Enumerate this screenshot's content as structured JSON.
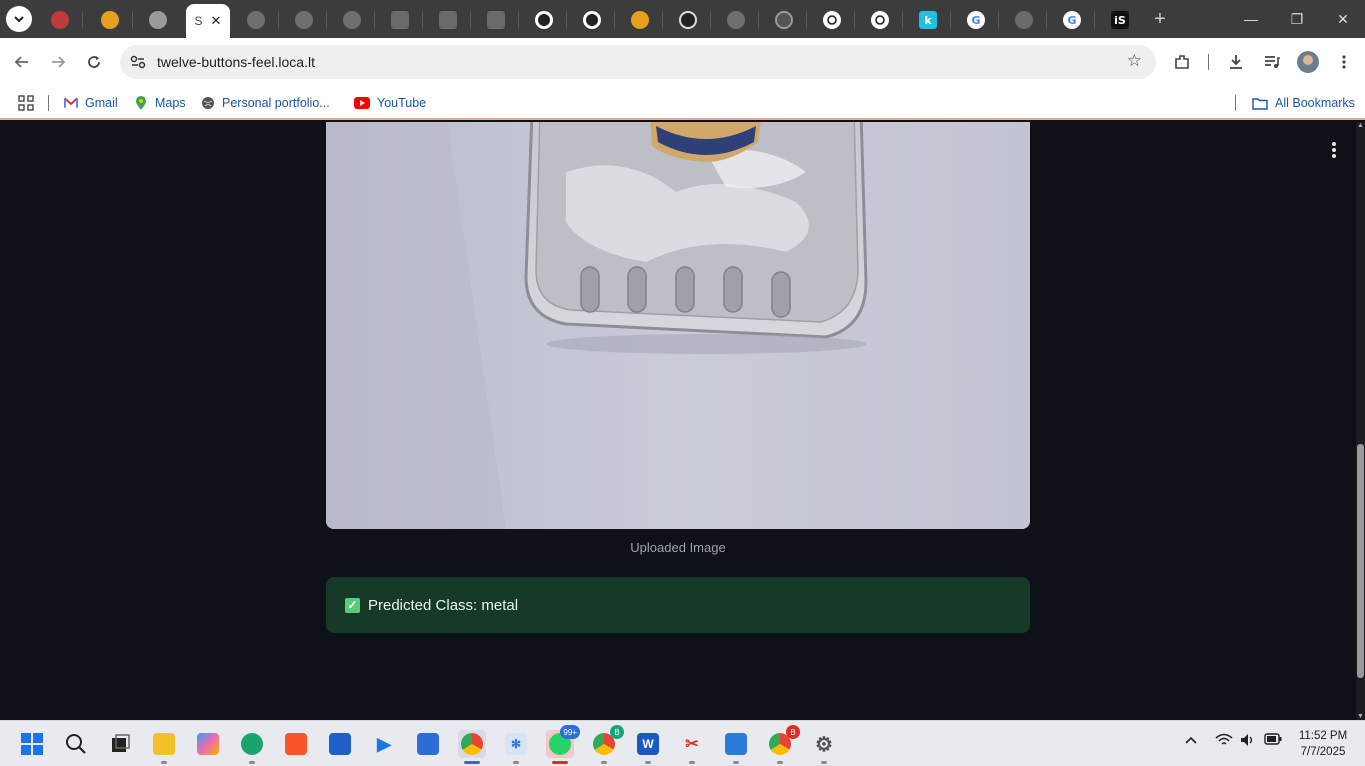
{
  "browser": {
    "active_tab_letter": "S",
    "url": "twelve-buttons-feel.loca.lt",
    "bookmarks": [
      {
        "label": "Gmail",
        "icon": "gmail-icon"
      },
      {
        "label": "Maps",
        "icon": "maps-icon"
      },
      {
        "label": "Personal portfolio...",
        "icon": "globe-icon"
      },
      {
        "label": "YouTube",
        "icon": "youtube-icon"
      }
    ],
    "all_bookmarks_label": "All Bookmarks"
  },
  "app": {
    "image_caption": "Uploaded Image",
    "prediction_text": "Predicted Class: metal",
    "success_color": "#173928"
  },
  "taskbar": {
    "badges": {
      "whatsapp": "99+",
      "chrome_profile_1": "B",
      "chrome_profile_2": "B"
    },
    "time": "11:52 PM",
    "date": "7/7/2025"
  }
}
